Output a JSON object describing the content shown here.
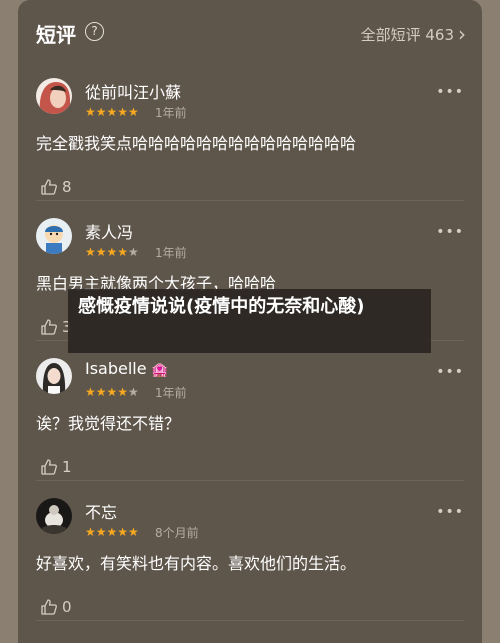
{
  "header": {
    "title": "短评",
    "help_icon": "?",
    "all_link": "全部短评 463",
    "chevron": "›"
  },
  "reviews": [
    {
      "username": "從前叫汪小蘇",
      "rating": 5,
      "time": "1年前",
      "content": "完全戳我笑点哈哈哈哈哈哈哈哈哈哈哈哈哈哈",
      "likes": "8"
    },
    {
      "username": "素人冯",
      "rating": 4,
      "time": "1年前",
      "content": "黑白男主就像两个大孩子，哈哈哈",
      "likes": "3"
    },
    {
      "username": "Isabelle",
      "badge": "🏩",
      "rating": 4,
      "time": "1年前",
      "content": "诶？我觉得还不错？",
      "likes": "1"
    },
    {
      "username": "不忘",
      "rating": 5,
      "time": "8个月前",
      "content": "好喜欢，有笑料也有内容。喜欢他们的生活。",
      "likes": "0"
    }
  ],
  "overlay": {
    "title": "感慨疫情说说(疫情中的无奈和心酸)"
  },
  "colors": {
    "background": "#8b7f71",
    "panel": "#5e554b",
    "star": "#f6a821",
    "star_empty": "#b6ada2"
  },
  "icons": [
    "help-icon",
    "chevron-right-icon",
    "more-icon",
    "thumb-up-icon",
    "avatar"
  ]
}
